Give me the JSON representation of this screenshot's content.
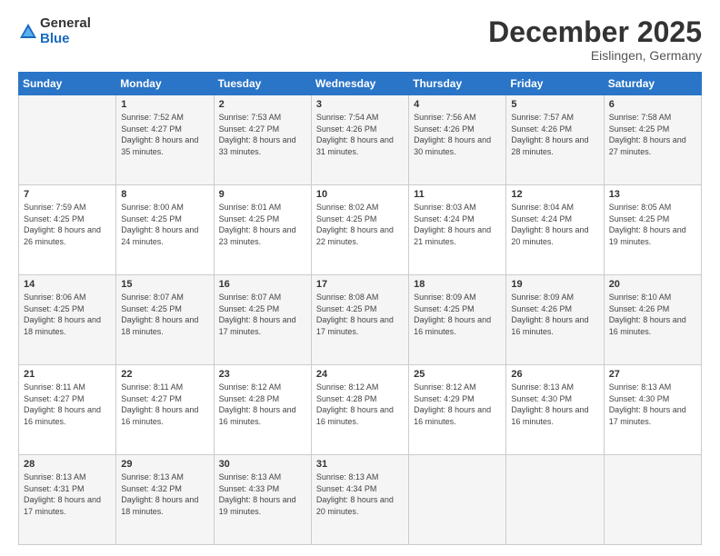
{
  "logo": {
    "general": "General",
    "blue": "Blue"
  },
  "header": {
    "month": "December 2025",
    "location": "Eislingen, Germany"
  },
  "weekdays": [
    "Sunday",
    "Monday",
    "Tuesday",
    "Wednesday",
    "Thursday",
    "Friday",
    "Saturday"
  ],
  "weeks": [
    [
      {
        "day": "",
        "sunrise": "",
        "sunset": "",
        "daylight": ""
      },
      {
        "day": "1",
        "sunrise": "Sunrise: 7:52 AM",
        "sunset": "Sunset: 4:27 PM",
        "daylight": "Daylight: 8 hours and 35 minutes."
      },
      {
        "day": "2",
        "sunrise": "Sunrise: 7:53 AM",
        "sunset": "Sunset: 4:27 PM",
        "daylight": "Daylight: 8 hours and 33 minutes."
      },
      {
        "day": "3",
        "sunrise": "Sunrise: 7:54 AM",
        "sunset": "Sunset: 4:26 PM",
        "daylight": "Daylight: 8 hours and 31 minutes."
      },
      {
        "day": "4",
        "sunrise": "Sunrise: 7:56 AM",
        "sunset": "Sunset: 4:26 PM",
        "daylight": "Daylight: 8 hours and 30 minutes."
      },
      {
        "day": "5",
        "sunrise": "Sunrise: 7:57 AM",
        "sunset": "Sunset: 4:26 PM",
        "daylight": "Daylight: 8 hours and 28 minutes."
      },
      {
        "day": "6",
        "sunrise": "Sunrise: 7:58 AM",
        "sunset": "Sunset: 4:25 PM",
        "daylight": "Daylight: 8 hours and 27 minutes."
      }
    ],
    [
      {
        "day": "7",
        "sunrise": "Sunrise: 7:59 AM",
        "sunset": "Sunset: 4:25 PM",
        "daylight": "Daylight: 8 hours and 26 minutes."
      },
      {
        "day": "8",
        "sunrise": "Sunrise: 8:00 AM",
        "sunset": "Sunset: 4:25 PM",
        "daylight": "Daylight: 8 hours and 24 minutes."
      },
      {
        "day": "9",
        "sunrise": "Sunrise: 8:01 AM",
        "sunset": "Sunset: 4:25 PM",
        "daylight": "Daylight: 8 hours and 23 minutes."
      },
      {
        "day": "10",
        "sunrise": "Sunrise: 8:02 AM",
        "sunset": "Sunset: 4:25 PM",
        "daylight": "Daylight: 8 hours and 22 minutes."
      },
      {
        "day": "11",
        "sunrise": "Sunrise: 8:03 AM",
        "sunset": "Sunset: 4:24 PM",
        "daylight": "Daylight: 8 hours and 21 minutes."
      },
      {
        "day": "12",
        "sunrise": "Sunrise: 8:04 AM",
        "sunset": "Sunset: 4:24 PM",
        "daylight": "Daylight: 8 hours and 20 minutes."
      },
      {
        "day": "13",
        "sunrise": "Sunrise: 8:05 AM",
        "sunset": "Sunset: 4:25 PM",
        "daylight": "Daylight: 8 hours and 19 minutes."
      }
    ],
    [
      {
        "day": "14",
        "sunrise": "Sunrise: 8:06 AM",
        "sunset": "Sunset: 4:25 PM",
        "daylight": "Daylight: 8 hours and 18 minutes."
      },
      {
        "day": "15",
        "sunrise": "Sunrise: 8:07 AM",
        "sunset": "Sunset: 4:25 PM",
        "daylight": "Daylight: 8 hours and 18 minutes."
      },
      {
        "day": "16",
        "sunrise": "Sunrise: 8:07 AM",
        "sunset": "Sunset: 4:25 PM",
        "daylight": "Daylight: 8 hours and 17 minutes."
      },
      {
        "day": "17",
        "sunrise": "Sunrise: 8:08 AM",
        "sunset": "Sunset: 4:25 PM",
        "daylight": "Daylight: 8 hours and 17 minutes."
      },
      {
        "day": "18",
        "sunrise": "Sunrise: 8:09 AM",
        "sunset": "Sunset: 4:25 PM",
        "daylight": "Daylight: 8 hours and 16 minutes."
      },
      {
        "day": "19",
        "sunrise": "Sunrise: 8:09 AM",
        "sunset": "Sunset: 4:26 PM",
        "daylight": "Daylight: 8 hours and 16 minutes."
      },
      {
        "day": "20",
        "sunrise": "Sunrise: 8:10 AM",
        "sunset": "Sunset: 4:26 PM",
        "daylight": "Daylight: 8 hours and 16 minutes."
      }
    ],
    [
      {
        "day": "21",
        "sunrise": "Sunrise: 8:11 AM",
        "sunset": "Sunset: 4:27 PM",
        "daylight": "Daylight: 8 hours and 16 minutes."
      },
      {
        "day": "22",
        "sunrise": "Sunrise: 8:11 AM",
        "sunset": "Sunset: 4:27 PM",
        "daylight": "Daylight: 8 hours and 16 minutes."
      },
      {
        "day": "23",
        "sunrise": "Sunrise: 8:12 AM",
        "sunset": "Sunset: 4:28 PM",
        "daylight": "Daylight: 8 hours and 16 minutes."
      },
      {
        "day": "24",
        "sunrise": "Sunrise: 8:12 AM",
        "sunset": "Sunset: 4:28 PM",
        "daylight": "Daylight: 8 hours and 16 minutes."
      },
      {
        "day": "25",
        "sunrise": "Sunrise: 8:12 AM",
        "sunset": "Sunset: 4:29 PM",
        "daylight": "Daylight: 8 hours and 16 minutes."
      },
      {
        "day": "26",
        "sunrise": "Sunrise: 8:13 AM",
        "sunset": "Sunset: 4:30 PM",
        "daylight": "Daylight: 8 hours and 16 minutes."
      },
      {
        "day": "27",
        "sunrise": "Sunrise: 8:13 AM",
        "sunset": "Sunset: 4:30 PM",
        "daylight": "Daylight: 8 hours and 17 minutes."
      }
    ],
    [
      {
        "day": "28",
        "sunrise": "Sunrise: 8:13 AM",
        "sunset": "Sunset: 4:31 PM",
        "daylight": "Daylight: 8 hours and 17 minutes."
      },
      {
        "day": "29",
        "sunrise": "Sunrise: 8:13 AM",
        "sunset": "Sunset: 4:32 PM",
        "daylight": "Daylight: 8 hours and 18 minutes."
      },
      {
        "day": "30",
        "sunrise": "Sunrise: 8:13 AM",
        "sunset": "Sunset: 4:33 PM",
        "daylight": "Daylight: 8 hours and 19 minutes."
      },
      {
        "day": "31",
        "sunrise": "Sunrise: 8:13 AM",
        "sunset": "Sunset: 4:34 PM",
        "daylight": "Daylight: 8 hours and 20 minutes."
      },
      {
        "day": "",
        "sunrise": "",
        "sunset": "",
        "daylight": ""
      },
      {
        "day": "",
        "sunrise": "",
        "sunset": "",
        "daylight": ""
      },
      {
        "day": "",
        "sunrise": "",
        "sunset": "",
        "daylight": ""
      }
    ]
  ]
}
